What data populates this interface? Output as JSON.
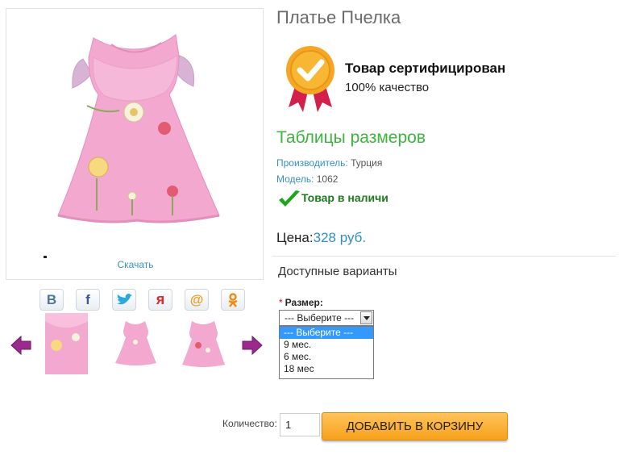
{
  "product": {
    "title": "Платье Пчелка",
    "download_label": "Скачать"
  },
  "certificate": {
    "title": "Товар сертифицирован",
    "subtitle": "100% качество",
    "badge_icon": "certificate-badge-icon"
  },
  "size_tables_link": "Таблицы размеров",
  "meta": {
    "manufacturer_label": "Производитель:",
    "manufacturer_value": " Турция",
    "model_label": "Модель:",
    "model_value": " 1062"
  },
  "stock": {
    "text": "Товар в наличи",
    "icon": "checkmark-icon"
  },
  "price": {
    "label": "Цена:",
    "value": "328 руб."
  },
  "variants": {
    "heading": "Доступные варианты",
    "size_label": "Размер:",
    "required_mark": "*",
    "selected": "--- Выберите ---",
    "options": [
      "--- Выберите ---",
      "9 мес.",
      "6 мес.",
      "18 мес"
    ]
  },
  "cart": {
    "quantity_label": "Количество:",
    "quantity_value": "1",
    "add_button": "ДОБАВИТЬ В КОРЗИНУ"
  },
  "social": [
    {
      "name": "vk-icon",
      "glyph": "В"
    },
    {
      "name": "facebook-icon",
      "glyph": "f"
    },
    {
      "name": "twitter-icon",
      "glyph": ""
    },
    {
      "name": "yaru-icon",
      "glyph": "я"
    },
    {
      "name": "mailru-icon",
      "glyph": "@"
    },
    {
      "name": "odnoklassniki-icon",
      "glyph": ""
    }
  ],
  "colors": {
    "accent_blue": "#2f8fc4",
    "green": "#3cb53c",
    "button_orange": "#f7a21b",
    "dress_pink": "#f0a8cf"
  }
}
